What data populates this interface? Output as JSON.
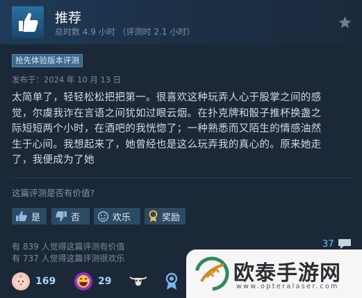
{
  "header": {
    "title": "推荐",
    "hours": "总时数 4.9 小时 （评测时 2.1 小时）",
    "thumb_icon": "thumbs-up-icon",
    "star_icon": "star-icon"
  },
  "tag": "抢先体验版本评测",
  "posted": "发布于：2024 年 10 月 13 日",
  "review_lines": [
    "太简单了，轻轻松松把把第一。很喜欢这种玩弄人心于股掌之间的感",
    "觉，尔虞我诈在言语之间犹如过眼云烟。在扑克牌和骰子推杯换盏之",
    "际短短两个小时，在酒吧的我恍惚了；一种熟悉而又陌生的情感油然",
    "生于心间。我想起来了，她曾经也是这么玩弄我的真心的。原来她走",
    "了，我便成为了她"
  ],
  "helpful_question": "这篇评测是否有价值?",
  "buttons": {
    "yes": "是",
    "no": "否",
    "funny": "欢乐",
    "award": "奖励"
  },
  "stats": {
    "helpful": "有 839 人觉得这篇评测有价值",
    "funny": "有 737 人觉得这篇评测很欢乐"
  },
  "comments": "37",
  "awards": [
    {
      "icon": "baby-face-icon",
      "count": "169"
    },
    {
      "icon": "laughing-face-icon",
      "count": "29"
    },
    {
      "icon": "cow-skull-icon",
      "count": ""
    },
    {
      "icon": "medal-icon",
      "count": ""
    }
  ],
  "watermark": {
    "text": "欧泰手游网",
    "url": "www.opteralaser.com"
  },
  "colors": {
    "background": "#1b2838",
    "accent": "#66c0f4",
    "button": "#2b4a63",
    "tag": "#3c668a"
  }
}
